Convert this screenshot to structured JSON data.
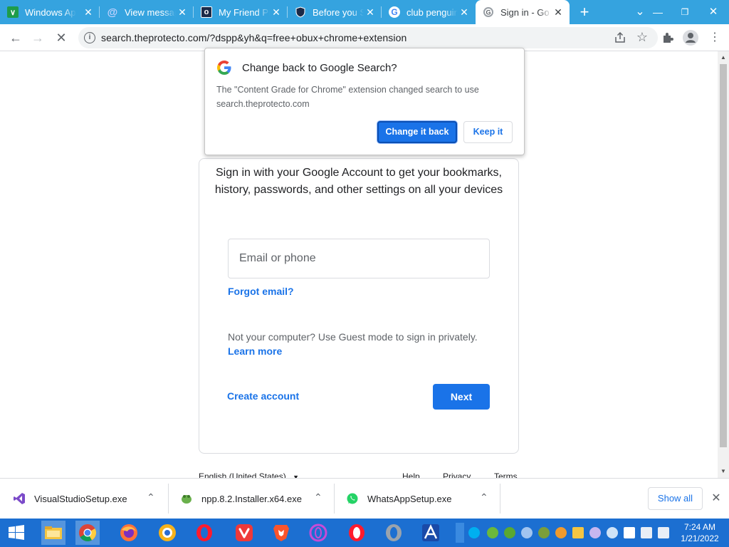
{
  "tabs": [
    {
      "title": "Windows Apps",
      "icon": "green-chevron-icon",
      "active": false
    },
    {
      "title": "View messages",
      "icon": "blue-at-icon",
      "active": false
    },
    {
      "title": "My Friend Pi",
      "icon": "dark-square-icon",
      "active": false
    },
    {
      "title": "Before you S",
      "icon": "shield-icon",
      "active": false
    },
    {
      "title": "club penguin",
      "icon": "google-g-icon",
      "active": false
    },
    {
      "title": "Sign in - Go",
      "icon": "loading-google-icon",
      "active": true
    }
  ],
  "new_tab_symbol": "+",
  "address_bar": {
    "url": "search.theprotecto.com/?dspp&yh&q=free+obux+chrome+extension"
  },
  "popup": {
    "title": "Change back to Google Search?",
    "body": "The \"Content Grade for Chrome\" extension changed search to use search.theprotecto.com",
    "primary_button": "Change it back",
    "secondary_button": "Keep it"
  },
  "signin": {
    "description": "Sign in with your Google Account to get your bookmarks, history, passwords, and other settings on all your devices",
    "email_placeholder": "Email or phone",
    "forgot_email": "Forgot email?",
    "guest_text": "Not your computer? Use Guest mode to sign in privately.",
    "learn_more": "Learn more",
    "create_account": "Create account",
    "next": "Next"
  },
  "footer": {
    "language": "English (United States)",
    "links": [
      "Help",
      "Privacy",
      "Terms"
    ]
  },
  "downloads": [
    {
      "name": "VisualStudioSetup.exe",
      "icon": "visual-studio-icon"
    },
    {
      "name": "npp.8.2.Installer.x64.exe",
      "icon": "notepad-plus-plus-icon"
    },
    {
      "name": "WhatsAppSetup.exe",
      "icon": "whatsapp-icon"
    }
  ],
  "show_all": "Show all",
  "taskbar": {
    "time": "7:24 AM",
    "date": "1/21/2022"
  },
  "colors": {
    "tabstrip": "#35a3df",
    "primary": "#1a73e8",
    "taskbar": "#1c6fd1"
  }
}
